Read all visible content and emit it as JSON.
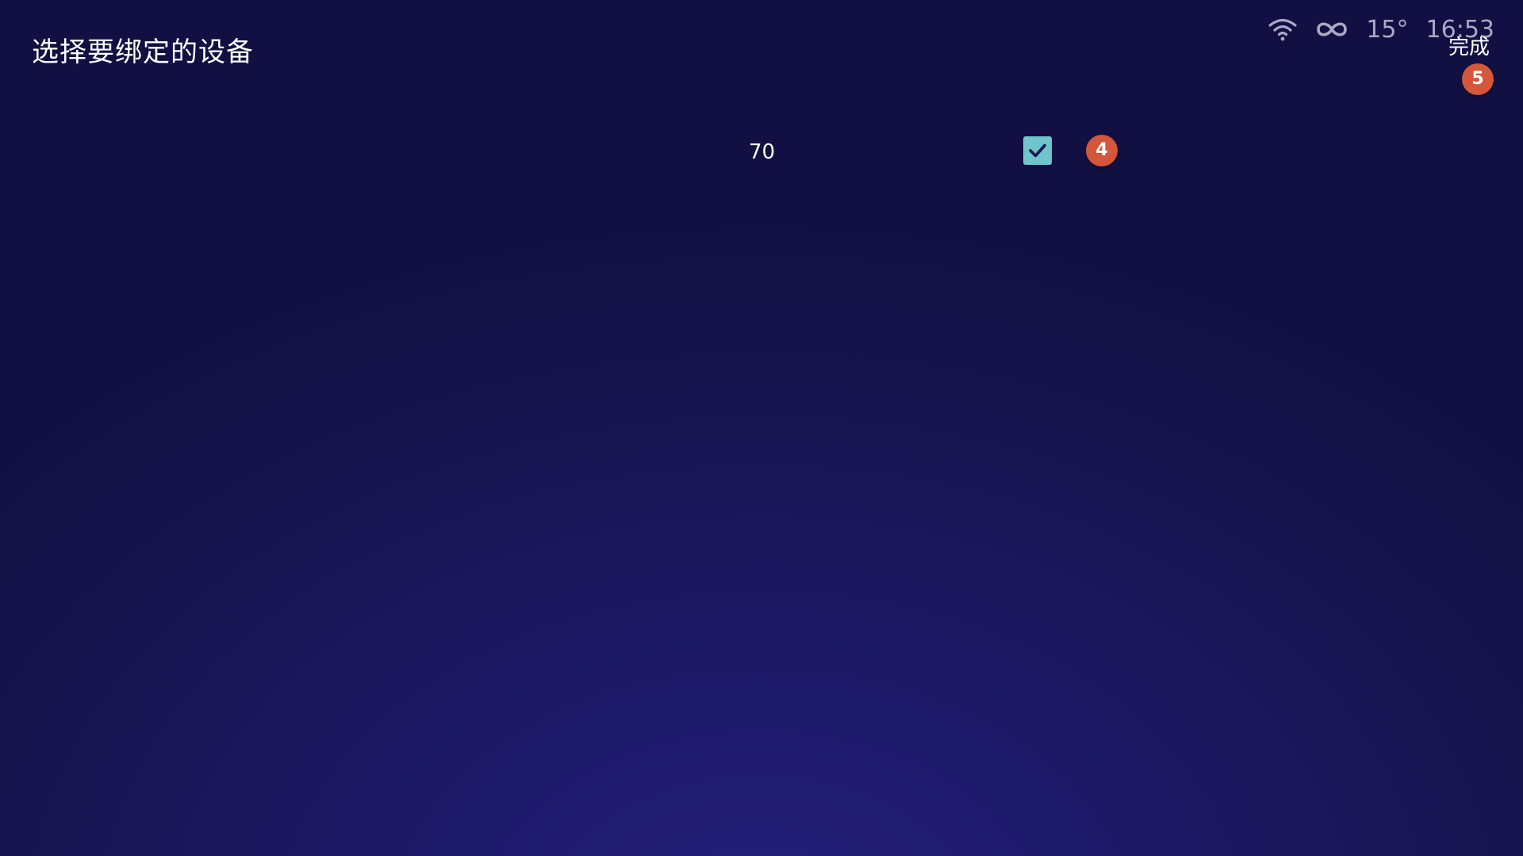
{
  "header": {
    "title": "选择要绑定的设备",
    "done_label": "完成"
  },
  "status_bar": {
    "temperature": "15°",
    "time": "16:53",
    "icons": [
      "wifi-icon",
      "infinity-icon"
    ]
  },
  "badges": {
    "done": "5",
    "device": "4"
  },
  "devices": [
    {
      "name": "70",
      "checked": true
    }
  ],
  "colors": {
    "background": "#15134c",
    "checkbox": "#6ec6cc",
    "badge": "#d4573c",
    "status_text": "#a9a8c6"
  }
}
